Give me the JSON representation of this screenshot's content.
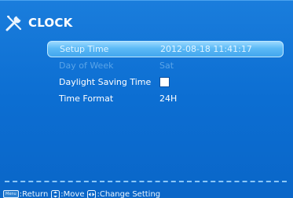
{
  "header": {
    "icon": "tools-icon",
    "title": "CLOCK"
  },
  "menu": {
    "items": [
      {
        "label": "Setup Time",
        "value": "2012-08-18 11:41:17",
        "state": "selected"
      },
      {
        "label": "Day of Week",
        "value": "Sat",
        "state": "disabled"
      },
      {
        "label": "Daylight Saving Time",
        "value": "",
        "state": "normal",
        "control": "checkbox",
        "checked": false
      },
      {
        "label": "Time Format",
        "value": "24H",
        "state": "normal"
      }
    ]
  },
  "footer": {
    "return_key": "Menu",
    "return_label": ":Return",
    "move_icon": "up-down-arrow-icon",
    "move_label": ":Move",
    "change_icon": "left-right-arrow-icon",
    "change_label": ":Change Setting"
  },
  "colors": {
    "background": "#0c6ed2",
    "selection": "#5cbaf6",
    "disabled_text": "#5aa4e8",
    "text": "#ffffff"
  }
}
